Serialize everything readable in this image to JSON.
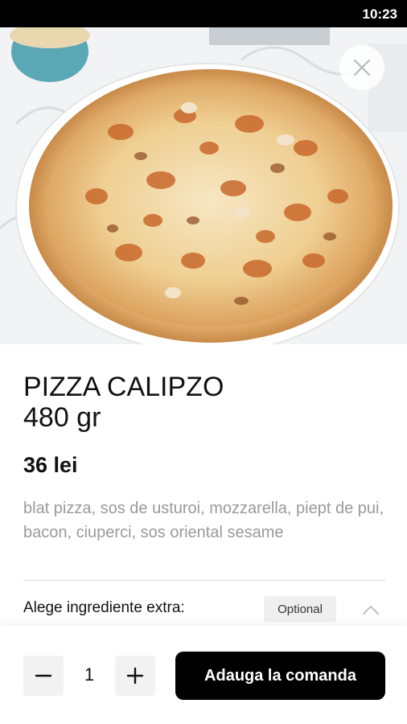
{
  "status_bar": {
    "time": "10:23"
  },
  "product": {
    "name": "PIZZA CALIPZO",
    "weight": "480 gr",
    "price": "36 lei",
    "description": "blat pizza, sos de usturoi, mozzarella, piept de pui, bacon, ciuperci, sos oriental sesame"
  },
  "extras": {
    "label": "Alege ingrediente extra:",
    "badge": "Optional"
  },
  "order": {
    "quantity": "1",
    "add_label": "Adauga la comanda"
  },
  "icons": {
    "close": "close-icon",
    "expand": "chevron-up-icon",
    "minus": "minus-icon",
    "plus": "plus-icon"
  }
}
